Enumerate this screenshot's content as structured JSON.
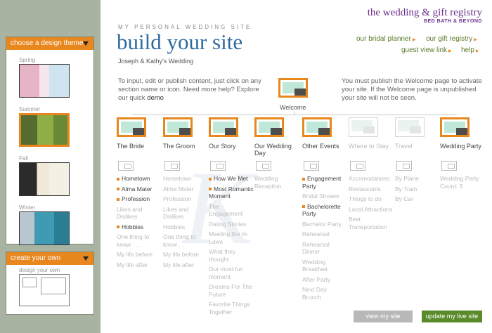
{
  "sidebar": {
    "design_theme_header": "choose a design theme",
    "themes": [
      {
        "label": "Spring"
      },
      {
        "label": "Summer"
      },
      {
        "label": "Fall"
      },
      {
        "label": "Winter"
      }
    ],
    "create_header": "create your own",
    "create_label": "design your own"
  },
  "header": {
    "eyebrow": "MY PERSONAL WEDDING SITE",
    "title": "build your site",
    "couple": "Joseph & Kathy's Wedding"
  },
  "brand": {
    "name": "the wedding & gift registry",
    "sub": "BED BATH & BEYOND"
  },
  "links": {
    "planner": "our bridal planner",
    "registry": "our gift registry",
    "guest_view": "guest view link",
    "help": "help"
  },
  "intro": {
    "left_text": "To input, edit or publish content, just click on any section name or icon.  Need more help? Explore our quick",
    "left_link": "demo",
    "right_text": "You must publish the Welcome page to activate your site. If the Welcome page is unpublished your site will not be seen."
  },
  "welcome": {
    "label": "Welcome"
  },
  "sections": [
    {
      "title": "The Bride",
      "items": [
        {
          "t": "Hometown",
          "on": true
        },
        {
          "t": "Alma Mater",
          "on": true
        },
        {
          "t": "Profession",
          "on": true
        },
        {
          "t": "Likes and Dislikes",
          "on": false
        },
        {
          "t": "Hobbies",
          "on": true
        },
        {
          "t": "One thing to know . . .",
          "on": false
        },
        {
          "t": "My life before",
          "on": false
        },
        {
          "t": "My life after",
          "on": false
        }
      ]
    },
    {
      "title": "The Groom",
      "items": [
        {
          "t": "Hometown",
          "on": false
        },
        {
          "t": "Alma Mater",
          "on": false
        },
        {
          "t": "Profession",
          "on": false
        },
        {
          "t": "Likes and Dislikes",
          "on": false
        },
        {
          "t": "Hobbies",
          "on": false
        },
        {
          "t": "One thing to know . . .",
          "on": false
        },
        {
          "t": "My life before",
          "on": false
        },
        {
          "t": "My life after",
          "on": false
        }
      ]
    },
    {
      "title": "Our Story",
      "items": [
        {
          "t": "How We Met",
          "on": true
        },
        {
          "t": "Most Romantic Moment",
          "on": true
        },
        {
          "t": "The Engagement",
          "on": false
        },
        {
          "t": "Dating Stories",
          "on": false
        },
        {
          "t": "Meeting the In-Laws",
          "on": false
        },
        {
          "t": "What they thought",
          "on": false
        },
        {
          "t": "Our most fun moment",
          "on": false
        },
        {
          "t": "Dreams For The Future",
          "on": false
        },
        {
          "t": "Favorite Things Together",
          "on": false
        }
      ]
    },
    {
      "title": "Our Wedding Day",
      "items": [
        {
          "t": "Wedding Reception",
          "on": false
        }
      ]
    },
    {
      "title": "Other Events",
      "items": [
        {
          "t": "Engagement Party",
          "on": true
        },
        {
          "t": "Bridal Shower",
          "on": false
        },
        {
          "t": "Bachelorette Party",
          "on": true
        },
        {
          "t": "Bachelor Party",
          "on": false
        },
        {
          "t": "Rehearsal",
          "on": false
        },
        {
          "t": "Rehearsal Dinner",
          "on": false
        },
        {
          "t": "Wedding Breakfast",
          "on": false
        },
        {
          "t": "After Party",
          "on": false
        },
        {
          "t": "Next Day Brunch",
          "on": false
        }
      ]
    },
    {
      "title": "Where to Stay",
      "items": [
        {
          "t": "Accomodations",
          "on": false
        },
        {
          "t": "Restaurants",
          "on": false
        },
        {
          "t": "Things to do",
          "on": false
        },
        {
          "t": "Local Attractions",
          "on": false
        },
        {
          "t": "Best Transportation",
          "on": false
        }
      ]
    },
    {
      "title": "Travel",
      "items": [
        {
          "t": "By Plane",
          "on": false
        },
        {
          "t": "By Train",
          "on": false
        },
        {
          "t": "By Car",
          "on": false
        }
      ]
    },
    {
      "title": "Wedding Party",
      "items": [
        {
          "t": "Wedding Party Count: 3",
          "on": false
        }
      ]
    }
  ],
  "buttons": {
    "view": "view my site",
    "update": "update my live site"
  },
  "colors": {
    "accent": "#e8871e",
    "title_blue": "#2d6aa0",
    "link_green": "#5c7a2a",
    "brand_purple": "#6b2f8a"
  }
}
